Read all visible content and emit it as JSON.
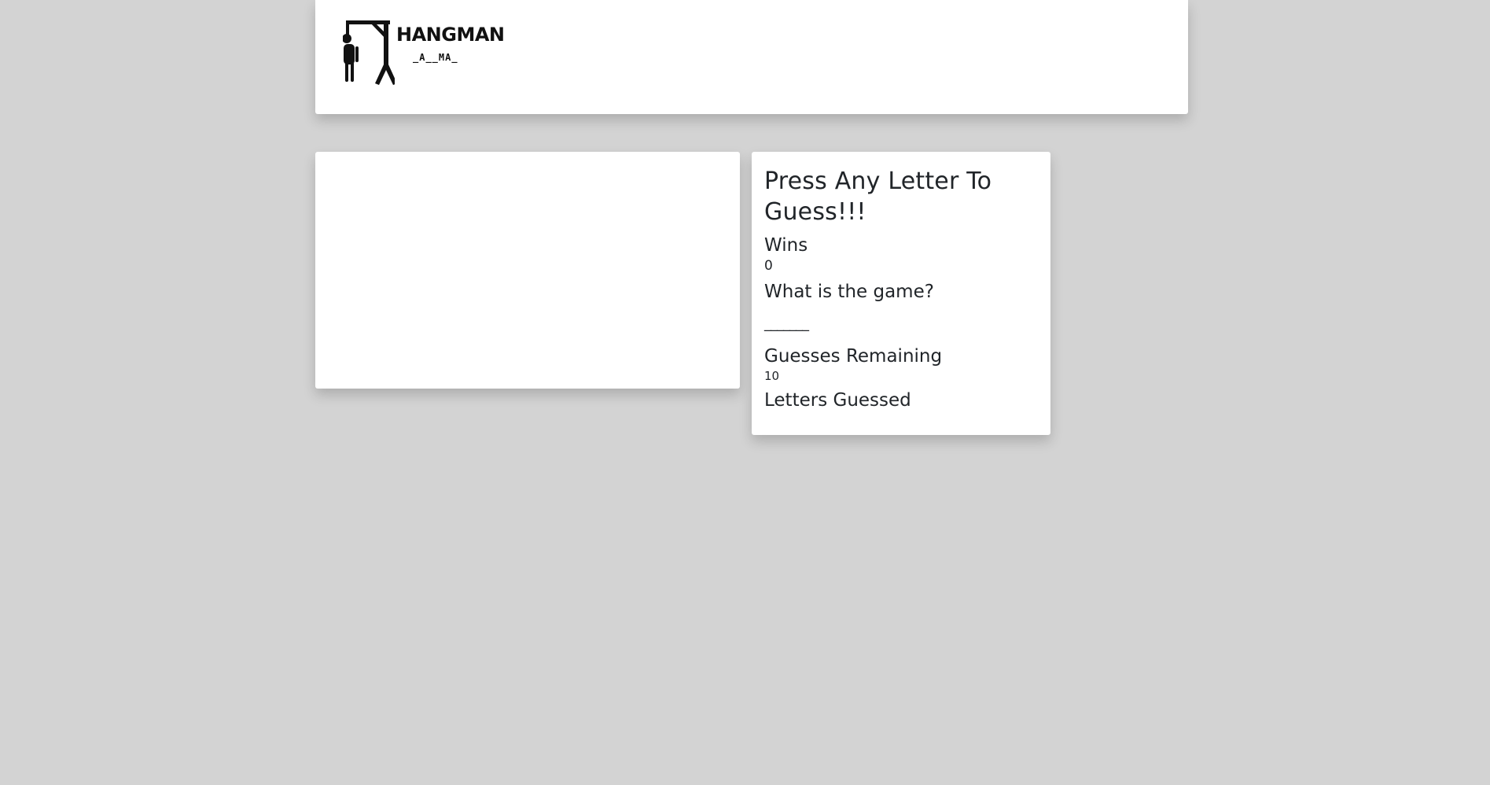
{
  "header": {
    "logo": {
      "title": "HANGMAN",
      "word": "_A__MA_",
      "icon": "gallows-icon"
    }
  },
  "game": {
    "prompt": "Press Any Letter To Guess!!!",
    "wins_label": "Wins",
    "wins_value": "0",
    "question_label": "What is the game?",
    "word_blanks": "_______",
    "guesses_label": "Guesses Remaining",
    "guesses_value": "10",
    "letters_label": "Letters Guessed",
    "letters_value": ""
  },
  "colors": {
    "background": "#d3d3d3",
    "card": "#ffffff",
    "text": "#212529"
  }
}
